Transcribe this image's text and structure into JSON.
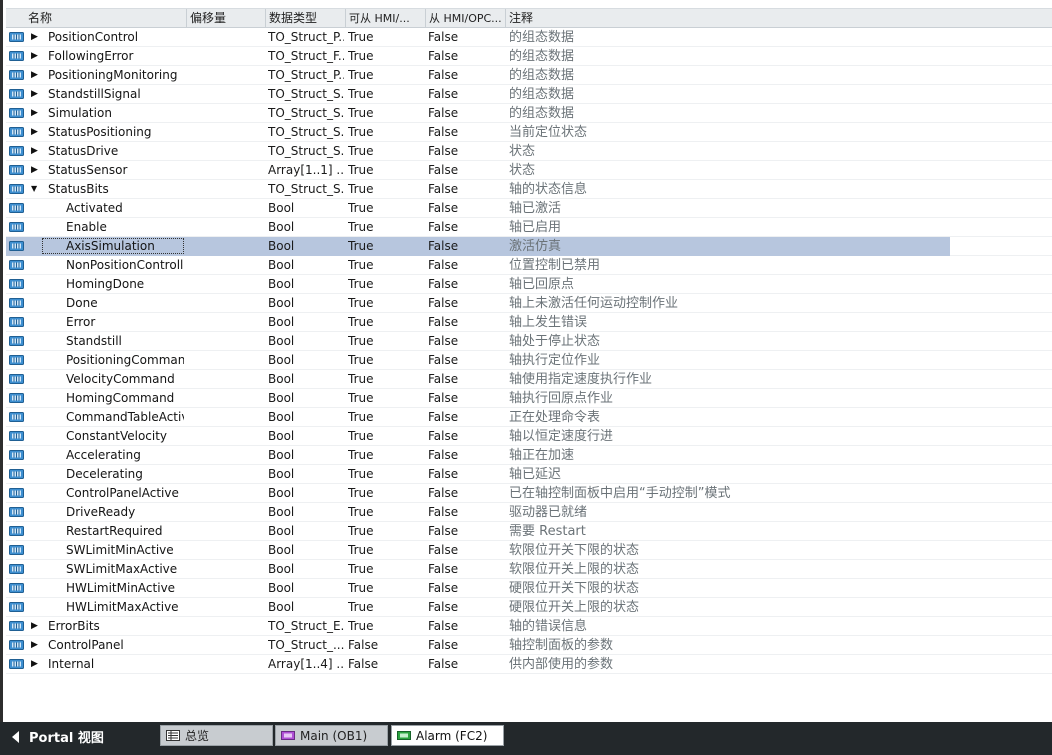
{
  "header": {
    "name": "名称",
    "offset": "偏移量",
    "datatype": "数据类型",
    "hmi_access": "可从 HMI/...",
    "hmi_visible": "从 HMI/OPC...",
    "comment": "注释"
  },
  "rows": [
    {
      "name": "PositionControl",
      "type": "TO_Struct_P...",
      "hmi1": "True",
      "hmi2": "False",
      "comment": "的组态数据",
      "level": 0,
      "expand": "collapsed"
    },
    {
      "name": "FollowingError",
      "type": "TO_Struct_F...",
      "hmi1": "True",
      "hmi2": "False",
      "comment": "的组态数据",
      "level": 0,
      "expand": "collapsed"
    },
    {
      "name": "PositioningMonitoring",
      "type": "TO_Struct_P...",
      "hmi1": "True",
      "hmi2": "False",
      "comment": "的组态数据",
      "level": 0,
      "expand": "collapsed"
    },
    {
      "name": "StandstillSignal",
      "type": "TO_Struct_S...",
      "hmi1": "True",
      "hmi2": "False",
      "comment": "的组态数据",
      "level": 0,
      "expand": "collapsed"
    },
    {
      "name": "Simulation",
      "type": "TO_Struct_S...",
      "hmi1": "True",
      "hmi2": "False",
      "comment": "的组态数据",
      "level": 0,
      "expand": "collapsed"
    },
    {
      "name": "StatusPositioning",
      "type": "TO_Struct_S...",
      "hmi1": "True",
      "hmi2": "False",
      "comment": "当前定位状态",
      "level": 0,
      "expand": "collapsed"
    },
    {
      "name": "StatusDrive",
      "type": "TO_Struct_S...",
      "hmi1": "True",
      "hmi2": "False",
      "comment": "状态",
      "level": 0,
      "expand": "collapsed"
    },
    {
      "name": "StatusSensor",
      "type": "Array[1..1] ...",
      "hmi1": "True",
      "hmi2": "False",
      "comment": "状态",
      "level": 0,
      "expand": "collapsed"
    },
    {
      "name": "StatusBits",
      "type": "TO_Struct_S...",
      "hmi1": "True",
      "hmi2": "False",
      "comment": "轴的状态信息",
      "level": 0,
      "expand": "expanded"
    },
    {
      "name": "Activated",
      "type": "Bool",
      "hmi1": "True",
      "hmi2": "False",
      "comment": "轴已激活",
      "level": 1,
      "expand": "none"
    },
    {
      "name": "Enable",
      "type": "Bool",
      "hmi1": "True",
      "hmi2": "False",
      "comment": "轴已启用",
      "level": 1,
      "expand": "none"
    },
    {
      "name": "AxisSimulation",
      "type": "Bool",
      "hmi1": "True",
      "hmi2": "False",
      "comment": "激活仿真",
      "level": 1,
      "expand": "none",
      "selected": true
    },
    {
      "name": "NonPositionControll...",
      "type": "Bool",
      "hmi1": "True",
      "hmi2": "False",
      "comment": "位置控制已禁用",
      "level": 1,
      "expand": "none"
    },
    {
      "name": "HomingDone",
      "type": "Bool",
      "hmi1": "True",
      "hmi2": "False",
      "comment": "轴已回原点",
      "level": 1,
      "expand": "none"
    },
    {
      "name": "Done",
      "type": "Bool",
      "hmi1": "True",
      "hmi2": "False",
      "comment": "轴上未激活任何运动控制作业",
      "level": 1,
      "expand": "none"
    },
    {
      "name": "Error",
      "type": "Bool",
      "hmi1": "True",
      "hmi2": "False",
      "comment": "轴上发生错误",
      "level": 1,
      "expand": "none"
    },
    {
      "name": "Standstill",
      "type": "Bool",
      "hmi1": "True",
      "hmi2": "False",
      "comment": "轴处于停止状态",
      "level": 1,
      "expand": "none"
    },
    {
      "name": "PositioningCommand",
      "type": "Bool",
      "hmi1": "True",
      "hmi2": "False",
      "comment": "轴执行定位作业",
      "level": 1,
      "expand": "none"
    },
    {
      "name": "VelocityCommand",
      "type": "Bool",
      "hmi1": "True",
      "hmi2": "False",
      "comment": "轴使用指定速度执行作业",
      "level": 1,
      "expand": "none"
    },
    {
      "name": "HomingCommand",
      "type": "Bool",
      "hmi1": "True",
      "hmi2": "False",
      "comment": "轴执行回原点作业",
      "level": 1,
      "expand": "none"
    },
    {
      "name": "CommandTableActive",
      "type": "Bool",
      "hmi1": "True",
      "hmi2": "False",
      "comment": "正在处理命令表",
      "level": 1,
      "expand": "none"
    },
    {
      "name": "ConstantVelocity",
      "type": "Bool",
      "hmi1": "True",
      "hmi2": "False",
      "comment": "轴以恒定速度行进",
      "level": 1,
      "expand": "none"
    },
    {
      "name": "Accelerating",
      "type": "Bool",
      "hmi1": "True",
      "hmi2": "False",
      "comment": "轴正在加速",
      "level": 1,
      "expand": "none"
    },
    {
      "name": "Decelerating",
      "type": "Bool",
      "hmi1": "True",
      "hmi2": "False",
      "comment": "轴已延迟",
      "level": 1,
      "expand": "none"
    },
    {
      "name": "ControlPanelActive",
      "type": "Bool",
      "hmi1": "True",
      "hmi2": "False",
      "comment": "已在轴控制面板中启用“手动控制”模式",
      "level": 1,
      "expand": "none"
    },
    {
      "name": "DriveReady",
      "type": "Bool",
      "hmi1": "True",
      "hmi2": "False",
      "comment": "驱动器已就绪",
      "level": 1,
      "expand": "none"
    },
    {
      "name": "RestartRequired",
      "type": "Bool",
      "hmi1": "True",
      "hmi2": "False",
      "comment": "需要 Restart",
      "level": 1,
      "expand": "none"
    },
    {
      "name": "SWLimitMinActive",
      "type": "Bool",
      "hmi1": "True",
      "hmi2": "False",
      "comment": "软限位开关下限的状态",
      "level": 1,
      "expand": "none"
    },
    {
      "name": "SWLimitMaxActive",
      "type": "Bool",
      "hmi1": "True",
      "hmi2": "False",
      "comment": "软限位开关上限的状态",
      "level": 1,
      "expand": "none"
    },
    {
      "name": "HWLimitMinActive",
      "type": "Bool",
      "hmi1": "True",
      "hmi2": "False",
      "comment": "硬限位开关下限的状态",
      "level": 1,
      "expand": "none"
    },
    {
      "name": "HWLimitMaxActive",
      "type": "Bool",
      "hmi1": "True",
      "hmi2": "False",
      "comment": "硬限位开关上限的状态",
      "level": 1,
      "expand": "none"
    },
    {
      "name": "ErrorBits",
      "type": "TO_Struct_E...",
      "hmi1": "True",
      "hmi2": "False",
      "comment": "轴的错误信息",
      "level": 0,
      "expand": "collapsed"
    },
    {
      "name": "ControlPanel",
      "type": "TO_Struct_...",
      "hmi1": "False",
      "hmi2": "False",
      "comment": "轴控制面板的参数",
      "level": 0,
      "expand": "collapsed"
    },
    {
      "name": "Internal",
      "type": "Array[1..4] ...",
      "hmi1": "False",
      "hmi2": "False",
      "comment": "供内部使用的参数",
      "level": 0,
      "expand": "collapsed"
    }
  ],
  "footer": {
    "portal_label": "Portal 视图",
    "tabs": [
      {
        "label": "总览",
        "icon": "overview-icon",
        "active": false
      },
      {
        "label": "Main (OB1)",
        "icon": "ob-block-icon",
        "active": false
      },
      {
        "label": "Alarm (FC2)",
        "icon": "fc-block-icon",
        "active": true
      }
    ]
  },
  "colors": {
    "selection": "#b7c6de",
    "row_icon": "#3d8fd1",
    "ob_icon": "#b04fd6",
    "fc_icon": "#2aa33f",
    "taskbar": "#23282b"
  }
}
